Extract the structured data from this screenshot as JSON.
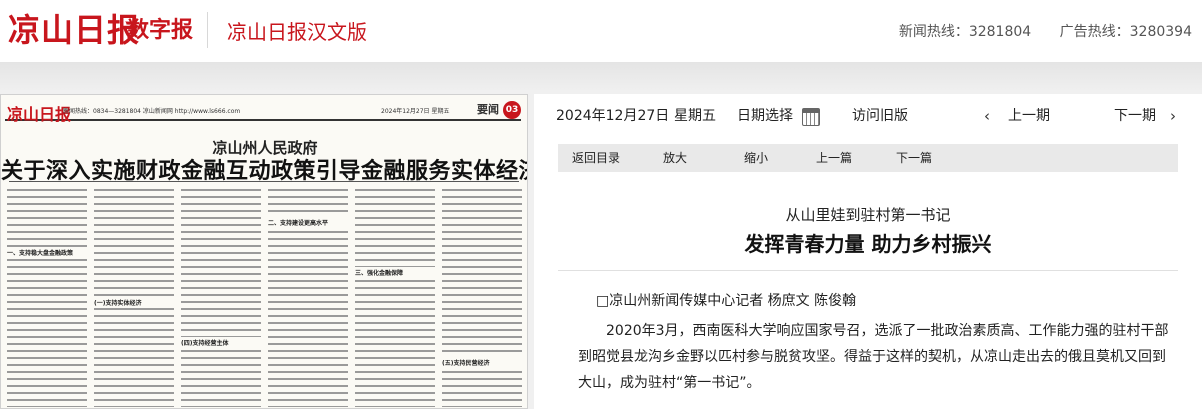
{
  "header": {
    "logo_text": "凉山日报",
    "digital_label": "数字报",
    "edition_name": "凉山日报汉文版",
    "news_hotline": "新闻热线：3281804",
    "ad_hotline": "广告热线：3280394"
  },
  "paper_page": {
    "masthead": "凉山日报",
    "meta": "新闻热线：0834—3281804   凉山新闻网 http://www.ls666.com",
    "date": "2024年12月27日 星期五",
    "section": "要闻",
    "page_number": "03",
    "kicker": "凉山州人民政府",
    "headline": "关于深入实施财政金融互动政策引导金融服务实体经济的实施方案",
    "subheads": [
      "一、支持稳大盘金融政策",
      "(一)支持实体经济",
      "(四)支持经营主体",
      "二、支持建设更高水平",
      "三、强化金融保障",
      "(五)支持民营经济"
    ]
  },
  "toolbar": {
    "date_label": "2024年12月27日",
    "weekday": "星期五",
    "date_select_label": "日期选择",
    "old_version_label": "访问旧版",
    "prev_period_label": "上一期",
    "next_period_label": "下一期",
    "back_catalog_label": "返回目录",
    "zoom_in_label": "放大",
    "zoom_out_label": "缩小",
    "prev_article_label": "上一篇",
    "next_article_label": "下一篇"
  },
  "article": {
    "subtitle": "从山里娃到驻村第一书记",
    "title": "发挥青春力量 助力乡村振兴",
    "byline": "□凉山州新闻传媒中心记者   杨庶文   陈俊翰",
    "paragraph1": "2020年3月，西南医科大学响应国家号召，选派了一批政治素质高、工作能力强的驻村干部到昭觉县龙沟乡金野以匹村参与脱贫攻坚。得益于这样的契机，从凉山走出去的俄且莫机又回到大山，成为驻村“第一书记”。"
  },
  "colors": {
    "brand_red": "#c8161d",
    "toolbar_gray": "#e9e9e9"
  }
}
